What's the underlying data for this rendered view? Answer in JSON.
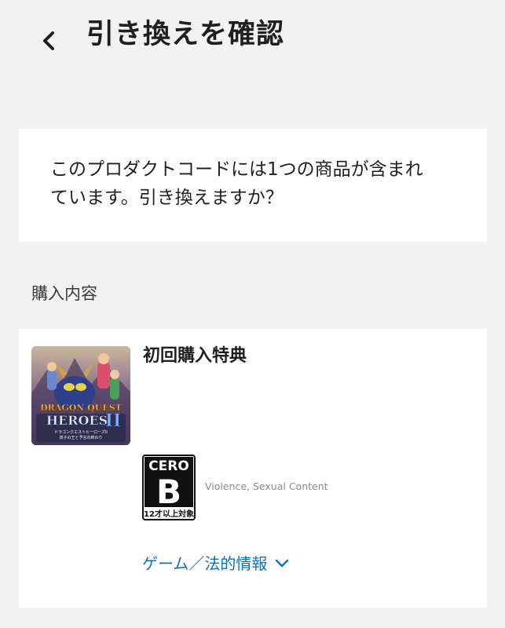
{
  "header": {
    "back_icon": "chevron-left-icon",
    "title": "引き換えを確認"
  },
  "message": {
    "line1": "このプロダクトコードには1つの商品が含まれ",
    "line2": "ています。引き換えますか？"
  },
  "section": {
    "label": "購入内容"
  },
  "item": {
    "title": "初回購入特典",
    "thumbnail": {
      "logo_text": "DRAGON QUEST",
      "logo_sub": "HEROES",
      "numeral": "II",
      "caption1": "ドラゴンクエストヒーローズII",
      "caption2": "双子の王と予言の終わり"
    },
    "rating": {
      "brand": "CERO",
      "grade": "B",
      "age": "12才以上対象",
      "descriptors": "Violence, Sexual Content"
    },
    "legal_link_label": "ゲーム／法的情報",
    "legal_link_icon": "chevron-down-icon"
  },
  "colors": {
    "background": "#f2f2f2",
    "card": "#ffffff",
    "link": "#0b6fc7",
    "text": "#1f1f1f"
  }
}
